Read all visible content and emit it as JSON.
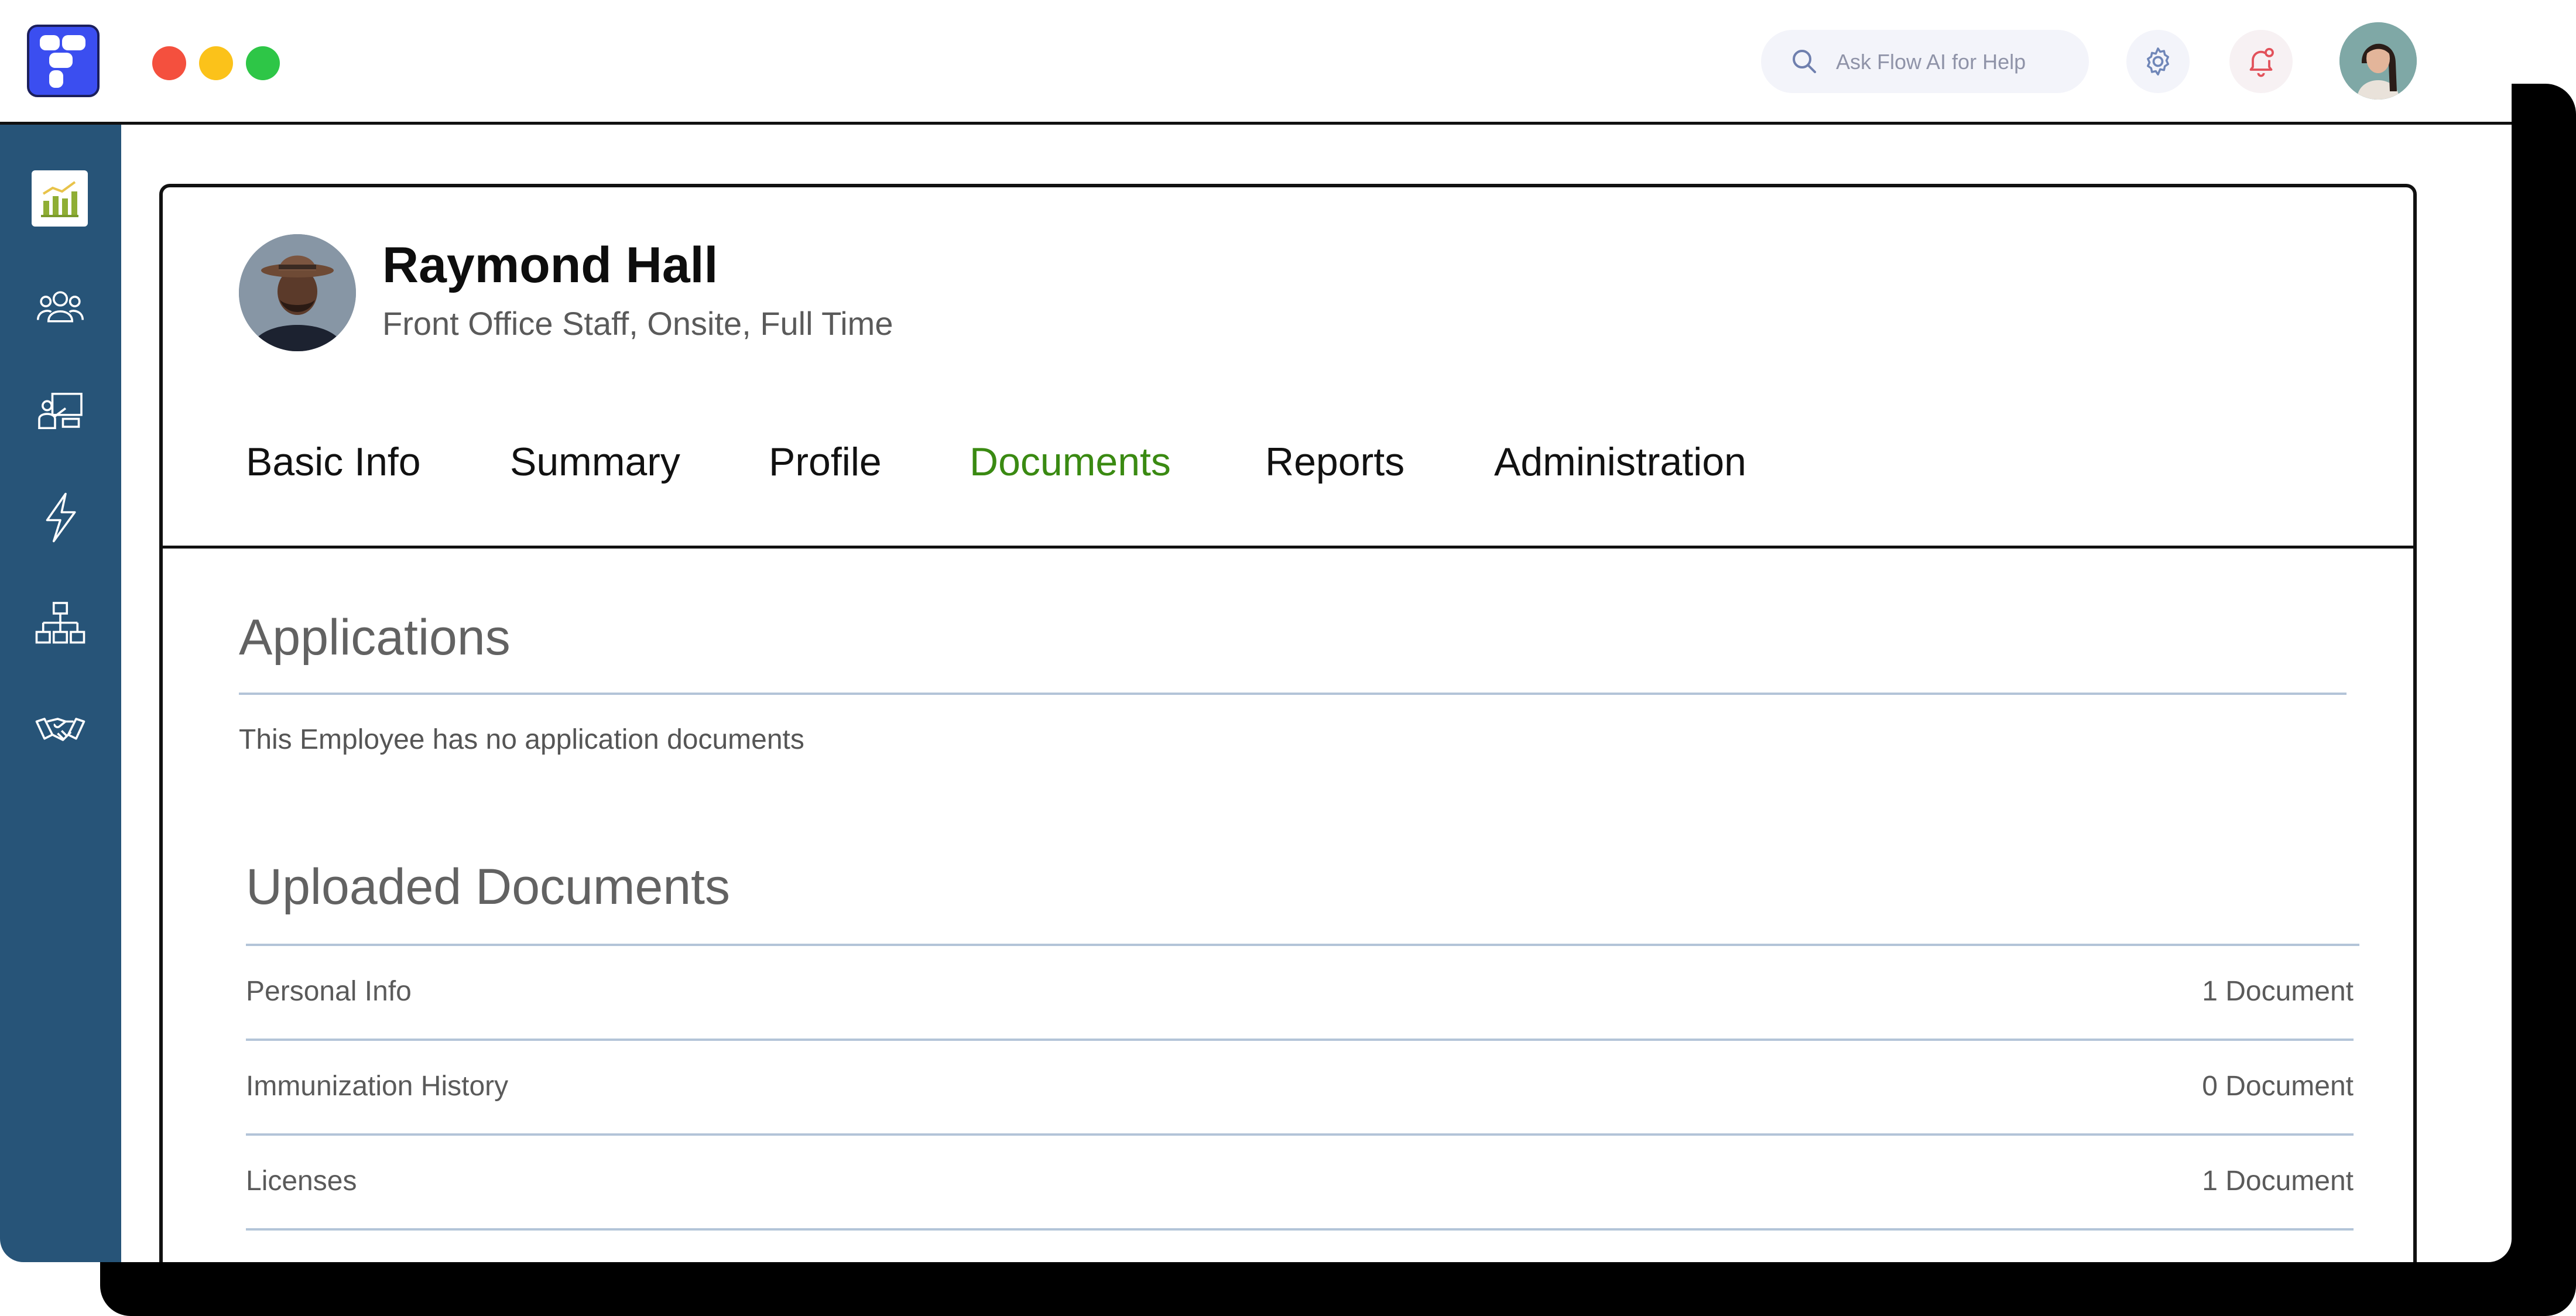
{
  "topbar": {
    "search_placeholder": "Ask Flow AI for Help",
    "settings_icon": "gear-icon",
    "notifications_icon": "bell-icon"
  },
  "sidebar": {
    "items": [
      {
        "icon": "analytics-icon",
        "active": true
      },
      {
        "icon": "people-icon",
        "active": false
      },
      {
        "icon": "presentation-icon",
        "active": false
      },
      {
        "icon": "lightning-icon",
        "active": false
      },
      {
        "icon": "org-chart-icon",
        "active": false
      },
      {
        "icon": "handshake-icon",
        "active": false
      }
    ]
  },
  "employee": {
    "name": "Raymond Hall",
    "role": "Front Office Staff, Onsite, Full Time"
  },
  "tabs": [
    {
      "label": "Basic Info",
      "active": false
    },
    {
      "label": "Summary",
      "active": false
    },
    {
      "label": "Profile",
      "active": false
    },
    {
      "label": "Documents",
      "active": true
    },
    {
      "label": "Reports",
      "active": false
    },
    {
      "label": "Administration",
      "active": false
    }
  ],
  "applications": {
    "title": "Applications",
    "empty_message": "This Employee has no application documents"
  },
  "uploaded": {
    "title": "Uploaded Documents",
    "rows": [
      {
        "label": "Personal Info",
        "count": "1 Document"
      },
      {
        "label": "Immunization History",
        "count": "0 Document"
      },
      {
        "label": "Licenses",
        "count": "1 Document"
      }
    ]
  },
  "colors": {
    "sidebar": "#275478",
    "active_tab": "#3a8a12",
    "logo": "#3b4ef0"
  }
}
